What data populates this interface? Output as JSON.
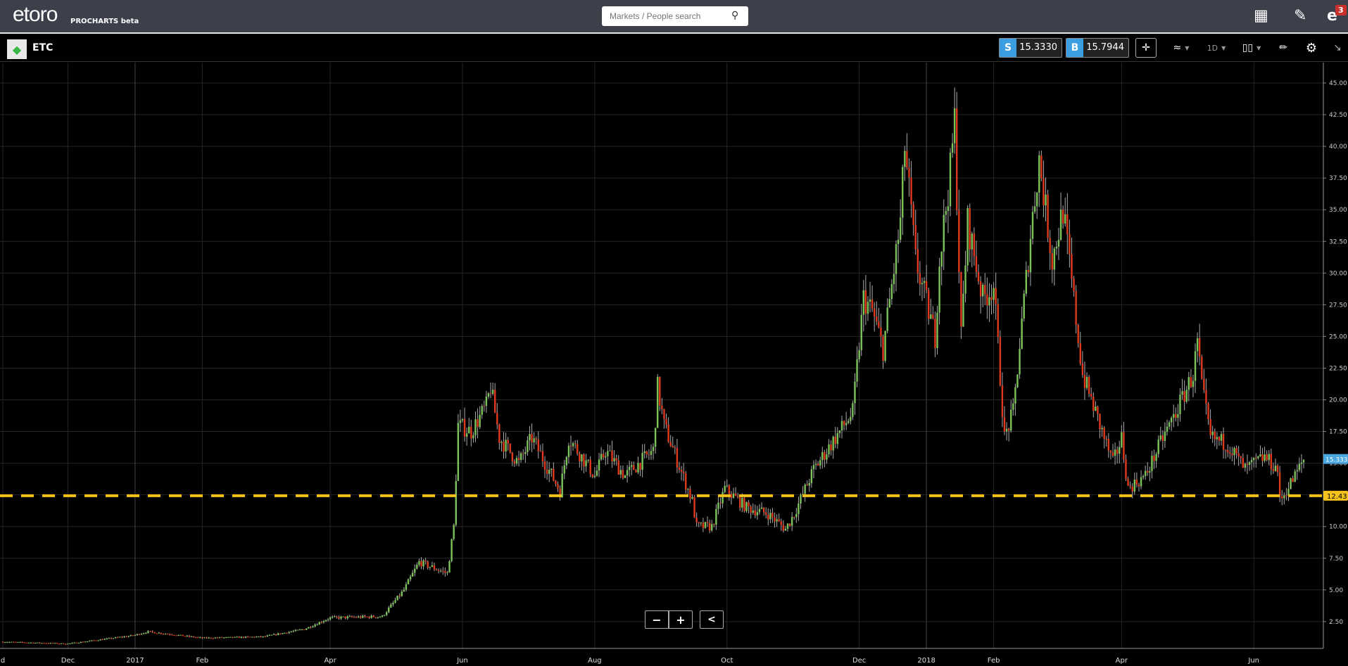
{
  "topbar": {
    "logo": "etoro",
    "product": "PROCHARTS beta",
    "search_placeholder": "Markets / People search",
    "notifications": "3"
  },
  "header": {
    "symbol": "ETC",
    "sell_label": "S",
    "sell_price": "15.3330",
    "buy_label": "B",
    "buy_price": "15.7944",
    "timeframe": "1D"
  },
  "icons": [
    "search-icon",
    "layout-icon",
    "pencil-icon",
    "etoro-user-icon",
    "crosshair-icon",
    "indicators-icon",
    "candles-icon",
    "drawing-icon",
    "gear-icon",
    "collapse-icon",
    "zoom-out-icon",
    "zoom-in-icon",
    "share-icon"
  ],
  "controls": {
    "zoom_out": "−",
    "zoom_in": "+"
  },
  "colors": {
    "up": "#7cc35a",
    "down": "#e0391c",
    "level": "#f5c21b",
    "price_tag": "#4aa8e0"
  },
  "chart_data": {
    "type": "candlestick",
    "title": "ETC 1D",
    "ylim": [
      0,
      46.5
    ],
    "yticks": [
      "2.50",
      "5.00",
      "7.50",
      "10.00",
      "12.50",
      "15.00",
      "17.50",
      "20.00",
      "22.50",
      "25.00",
      "27.50",
      "30.00",
      "32.50",
      "35.00",
      "37.50",
      "40.00",
      "42.50",
      "45.00"
    ],
    "xticks": [
      {
        "label": "d",
        "date": "2016-11-01"
      },
      {
        "label": "Dec",
        "date": "2016-12-01"
      },
      {
        "label": "2017",
        "date": "2017-01-01"
      },
      {
        "label": "Feb",
        "date": "2017-02-01"
      },
      {
        "label": "Apr",
        "date": "2017-04-01"
      },
      {
        "label": "Jun",
        "date": "2017-06-01"
      },
      {
        "label": "Aug",
        "date": "2017-08-01"
      },
      {
        "label": "Oct",
        "date": "2017-10-01"
      },
      {
        "label": "Dec",
        "date": "2017-12-01"
      },
      {
        "label": "2018",
        "date": "2018-01-01"
      },
      {
        "label": "Feb",
        "date": "2018-02-01"
      },
      {
        "label": "Apr",
        "date": "2018-04-01"
      },
      {
        "label": "Jun",
        "date": "2018-06-01"
      }
    ],
    "current_price": {
      "label": "15.3330",
      "value": 15.333
    },
    "level_line": {
      "label": "12.43",
      "value": 12.43
    },
    "approx_closes": [
      [
        "2016-11-01",
        0.9
      ],
      [
        "2016-12-01",
        0.75
      ],
      [
        "2016-12-31",
        1.4
      ],
      [
        "2017-01-07",
        1.7
      ],
      [
        "2017-02-01",
        1.2
      ],
      [
        "2017-03-01",
        1.3
      ],
      [
        "2017-03-20",
        1.9
      ],
      [
        "2017-04-01",
        2.8
      ],
      [
        "2017-04-25",
        2.9
      ],
      [
        "2017-05-05",
        5
      ],
      [
        "2017-05-12",
        7.2
      ],
      [
        "2017-05-25",
        6.3
      ],
      [
        "2017-05-28",
        10
      ],
      [
        "2017-05-30",
        18
      ],
      [
        "2017-06-05",
        17.5
      ],
      [
        "2017-06-12",
        19.5
      ],
      [
        "2017-06-14",
        21
      ],
      [
        "2017-06-18",
        17
      ],
      [
        "2017-06-27",
        15
      ],
      [
        "2017-07-03",
        17
      ],
      [
        "2017-07-16",
        12.8
      ],
      [
        "2017-07-20",
        17
      ],
      [
        "2017-08-01",
        14
      ],
      [
        "2017-08-06",
        16
      ],
      [
        "2017-08-15",
        14
      ],
      [
        "2017-08-28",
        16
      ],
      [
        "2017-08-30",
        21
      ],
      [
        "2017-09-02",
        18
      ],
      [
        "2017-09-15",
        12
      ],
      [
        "2017-09-17",
        10
      ],
      [
        "2017-09-24",
        10
      ],
      [
        "2017-09-30",
        13
      ],
      [
        "2017-10-10",
        11.5
      ],
      [
        "2017-10-20",
        11
      ],
      [
        "2017-10-28",
        9.8
      ],
      [
        "2017-11-01",
        11
      ],
      [
        "2017-11-10",
        14.5
      ],
      [
        "2017-11-20",
        17
      ],
      [
        "2017-11-28",
        19
      ],
      [
        "2017-12-03",
        28
      ],
      [
        "2017-12-07",
        27
      ],
      [
        "2017-12-12",
        24
      ],
      [
        "2017-12-20",
        34
      ],
      [
        "2017-12-22",
        40
      ],
      [
        "2017-12-27",
        31
      ],
      [
        "2018-01-05",
        25
      ],
      [
        "2018-01-07",
        31
      ],
      [
        "2018-01-12",
        38
      ],
      [
        "2018-01-14",
        42
      ],
      [
        "2018-01-17",
        25
      ],
      [
        "2018-01-20",
        34
      ],
      [
        "2018-01-27",
        28
      ],
      [
        "2018-02-01",
        29
      ],
      [
        "2018-02-06",
        17
      ],
      [
        "2018-02-10",
        19
      ],
      [
        "2018-02-18",
        33
      ],
      [
        "2018-02-22",
        39
      ],
      [
        "2018-02-28",
        31
      ],
      [
        "2018-03-05",
        35
      ],
      [
        "2018-03-14",
        22
      ],
      [
        "2018-03-20",
        19
      ],
      [
        "2018-03-28",
        15
      ],
      [
        "2018-04-01",
        17
      ],
      [
        "2018-04-04",
        13
      ],
      [
        "2018-04-12",
        14
      ],
      [
        "2018-04-20",
        17
      ],
      [
        "2018-04-26",
        19
      ],
      [
        "2018-05-04",
        22
      ],
      [
        "2018-05-06",
        24.5
      ],
      [
        "2018-05-08",
        21
      ],
      [
        "2018-05-12",
        17
      ],
      [
        "2018-05-20",
        16.5
      ],
      [
        "2018-05-28",
        14.5
      ],
      [
        "2018-06-06",
        15.5
      ],
      [
        "2018-06-12",
        14.5
      ],
      [
        "2018-06-13",
        12
      ],
      [
        "2018-06-20",
        14
      ],
      [
        "2018-06-24",
        15.3
      ]
    ]
  }
}
